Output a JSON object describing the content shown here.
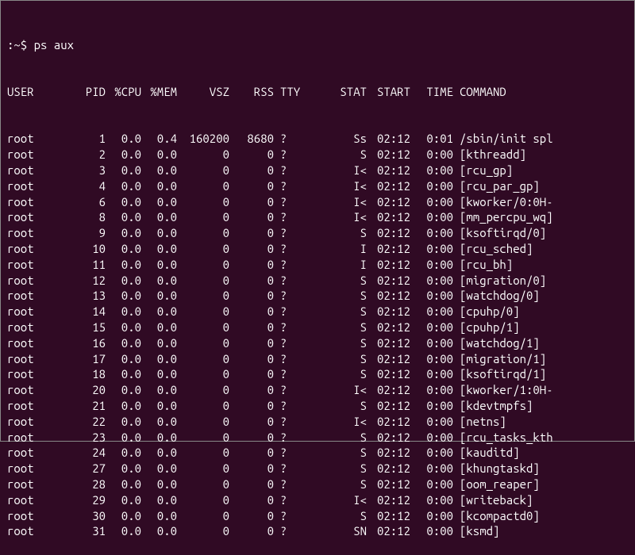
{
  "prompt": ":~$ ",
  "command": "ps aux",
  "headers": {
    "user": "USER",
    "pid": "PID",
    "cpu": "%CPU",
    "mem": "%MEM",
    "vsz": "VSZ",
    "rss": "RSS",
    "tty": "TTY",
    "stat": "STAT",
    "start": "START",
    "time": "TIME",
    "command": "COMMAND"
  },
  "rows": [
    {
      "user": "root",
      "pid": "1",
      "cpu": "0.0",
      "mem": "0.4",
      "vsz": "160200",
      "rss": "8680",
      "tty": "?",
      "stat": "Ss",
      "start": "02:12",
      "time": "0:01",
      "command": "/sbin/init spl"
    },
    {
      "user": "root",
      "pid": "2",
      "cpu": "0.0",
      "mem": "0.0",
      "vsz": "0",
      "rss": "0",
      "tty": "?",
      "stat": "S",
      "start": "02:12",
      "time": "0:00",
      "command": "[kthreadd]"
    },
    {
      "user": "root",
      "pid": "3",
      "cpu": "0.0",
      "mem": "0.0",
      "vsz": "0",
      "rss": "0",
      "tty": "?",
      "stat": "I<",
      "start": "02:12",
      "time": "0:00",
      "command": "[rcu_gp]"
    },
    {
      "user": "root",
      "pid": "4",
      "cpu": "0.0",
      "mem": "0.0",
      "vsz": "0",
      "rss": "0",
      "tty": "?",
      "stat": "I<",
      "start": "02:12",
      "time": "0:00",
      "command": "[rcu_par_gp]"
    },
    {
      "user": "root",
      "pid": "6",
      "cpu": "0.0",
      "mem": "0.0",
      "vsz": "0",
      "rss": "0",
      "tty": "?",
      "stat": "I<",
      "start": "02:12",
      "time": "0:00",
      "command": "[kworker/0:0H-"
    },
    {
      "user": "root",
      "pid": "8",
      "cpu": "0.0",
      "mem": "0.0",
      "vsz": "0",
      "rss": "0",
      "tty": "?",
      "stat": "I<",
      "start": "02:12",
      "time": "0:00",
      "command": "[mm_percpu_wq]"
    },
    {
      "user": "root",
      "pid": "9",
      "cpu": "0.0",
      "mem": "0.0",
      "vsz": "0",
      "rss": "0",
      "tty": "?",
      "stat": "S",
      "start": "02:12",
      "time": "0:00",
      "command": "[ksoftirqd/0]"
    },
    {
      "user": "root",
      "pid": "10",
      "cpu": "0.0",
      "mem": "0.0",
      "vsz": "0",
      "rss": "0",
      "tty": "?",
      "stat": "I",
      "start": "02:12",
      "time": "0:00",
      "command": "[rcu_sched]"
    },
    {
      "user": "root",
      "pid": "11",
      "cpu": "0.0",
      "mem": "0.0",
      "vsz": "0",
      "rss": "0",
      "tty": "?",
      "stat": "I",
      "start": "02:12",
      "time": "0:00",
      "command": "[rcu_bh]"
    },
    {
      "user": "root",
      "pid": "12",
      "cpu": "0.0",
      "mem": "0.0",
      "vsz": "0",
      "rss": "0",
      "tty": "?",
      "stat": "S",
      "start": "02:12",
      "time": "0:00",
      "command": "[migration/0]"
    },
    {
      "user": "root",
      "pid": "13",
      "cpu": "0.0",
      "mem": "0.0",
      "vsz": "0",
      "rss": "0",
      "tty": "?",
      "stat": "S",
      "start": "02:12",
      "time": "0:00",
      "command": "[watchdog/0]"
    },
    {
      "user": "root",
      "pid": "14",
      "cpu": "0.0",
      "mem": "0.0",
      "vsz": "0",
      "rss": "0",
      "tty": "?",
      "stat": "S",
      "start": "02:12",
      "time": "0:00",
      "command": "[cpuhp/0]"
    },
    {
      "user": "root",
      "pid": "15",
      "cpu": "0.0",
      "mem": "0.0",
      "vsz": "0",
      "rss": "0",
      "tty": "?",
      "stat": "S",
      "start": "02:12",
      "time": "0:00",
      "command": "[cpuhp/1]"
    },
    {
      "user": "root",
      "pid": "16",
      "cpu": "0.0",
      "mem": "0.0",
      "vsz": "0",
      "rss": "0",
      "tty": "?",
      "stat": "S",
      "start": "02:12",
      "time": "0:00",
      "command": "[watchdog/1]"
    },
    {
      "user": "root",
      "pid": "17",
      "cpu": "0.0",
      "mem": "0.0",
      "vsz": "0",
      "rss": "0",
      "tty": "?",
      "stat": "S",
      "start": "02:12",
      "time": "0:00",
      "command": "[migration/1]"
    },
    {
      "user": "root",
      "pid": "18",
      "cpu": "0.0",
      "mem": "0.0",
      "vsz": "0",
      "rss": "0",
      "tty": "?",
      "stat": "S",
      "start": "02:12",
      "time": "0:00",
      "command": "[ksoftirqd/1]"
    },
    {
      "user": "root",
      "pid": "20",
      "cpu": "0.0",
      "mem": "0.0",
      "vsz": "0",
      "rss": "0",
      "tty": "?",
      "stat": "I<",
      "start": "02:12",
      "time": "0:00",
      "command": "[kworker/1:0H-"
    },
    {
      "user": "root",
      "pid": "21",
      "cpu": "0.0",
      "mem": "0.0",
      "vsz": "0",
      "rss": "0",
      "tty": "?",
      "stat": "S",
      "start": "02:12",
      "time": "0:00",
      "command": "[kdevtmpfs]"
    },
    {
      "user": "root",
      "pid": "22",
      "cpu": "0.0",
      "mem": "0.0",
      "vsz": "0",
      "rss": "0",
      "tty": "?",
      "stat": "I<",
      "start": "02:12",
      "time": "0:00",
      "command": "[netns]"
    },
    {
      "user": "root",
      "pid": "23",
      "cpu": "0.0",
      "mem": "0.0",
      "vsz": "0",
      "rss": "0",
      "tty": "?",
      "stat": "S",
      "start": "02:12",
      "time": "0:00",
      "command": "[rcu_tasks_kth"
    },
    {
      "user": "root",
      "pid": "24",
      "cpu": "0.0",
      "mem": "0.0",
      "vsz": "0",
      "rss": "0",
      "tty": "?",
      "stat": "S",
      "start": "02:12",
      "time": "0:00",
      "command": "[kauditd]"
    },
    {
      "user": "root",
      "pid": "27",
      "cpu": "0.0",
      "mem": "0.0",
      "vsz": "0",
      "rss": "0",
      "tty": "?",
      "stat": "S",
      "start": "02:12",
      "time": "0:00",
      "command": "[khungtaskd]"
    },
    {
      "user": "root",
      "pid": "28",
      "cpu": "0.0",
      "mem": "0.0",
      "vsz": "0",
      "rss": "0",
      "tty": "?",
      "stat": "S",
      "start": "02:12",
      "time": "0:00",
      "command": "[oom_reaper]"
    },
    {
      "user": "root",
      "pid": "29",
      "cpu": "0.0",
      "mem": "0.0",
      "vsz": "0",
      "rss": "0",
      "tty": "?",
      "stat": "I<",
      "start": "02:12",
      "time": "0:00",
      "command": "[writeback]"
    },
    {
      "user": "root",
      "pid": "30",
      "cpu": "0.0",
      "mem": "0.0",
      "vsz": "0",
      "rss": "0",
      "tty": "?",
      "stat": "S",
      "start": "02:12",
      "time": "0:00",
      "command": "[kcompactd0]"
    },
    {
      "user": "root",
      "pid": "31",
      "cpu": "0.0",
      "mem": "0.0",
      "vsz": "0",
      "rss": "0",
      "tty": "?",
      "stat": "SN",
      "start": "02:12",
      "time": "0:00",
      "command": "[ksmd]"
    }
  ]
}
